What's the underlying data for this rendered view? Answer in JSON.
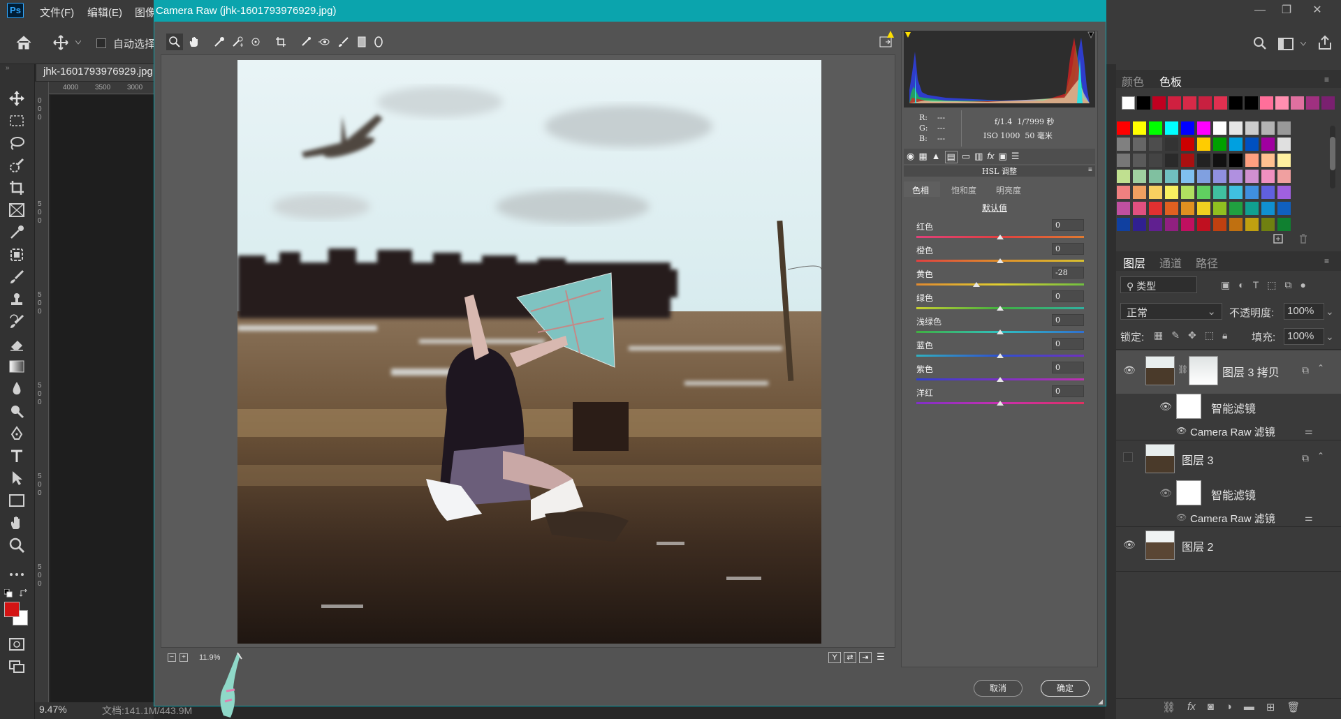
{
  "ps": {
    "menu": [
      "文件(F)",
      "编辑(E)",
      "图像"
    ],
    "logo": "Ps",
    "autoselect_label": "自动选择",
    "doc_tab": "jhk-1601793976929.jpg",
    "ruler_top": [
      "4000",
      "3500",
      "3000"
    ],
    "ruler_left": [
      "0",
      "0",
      "0",
      "5",
      "0",
      "0",
      "5",
      "0",
      "0",
      "5",
      "0",
      "0",
      "5",
      "0",
      "0",
      "5",
      "0",
      "0"
    ],
    "status_zoom": "9.47%",
    "status_doc": "文档:141.1M/443.9M",
    "window_buttons": [
      "—",
      "❐",
      "✕"
    ]
  },
  "camera_raw": {
    "title": "Camera Raw (jhk-1601793976929.jpg)",
    "zoom": "11.9%",
    "info": {
      "r_label": "R:",
      "g_label": "G:",
      "b_label": "B:",
      "r": "---",
      "g": "---",
      "b": "---",
      "aperture_shutter": "f/1.4  1/7999 秒",
      "iso_focal": "ISO 1000  50 毫米"
    },
    "panel_title": "HSL 调整",
    "subtabs": [
      "色相",
      "饱和度",
      "明亮度"
    ],
    "default_link": "默认值",
    "sliders": [
      {
        "label": "红色",
        "value": "0",
        "colors": [
          "#e0407a",
          "#e04040",
          "#e07a30"
        ]
      },
      {
        "label": "橙色",
        "value": "0",
        "colors": [
          "#e04040",
          "#e0902a",
          "#d8c030"
        ]
      },
      {
        "label": "黄色",
        "value": "-28",
        "colors": [
          "#e08a30",
          "#e0d030",
          "#70c040"
        ]
      },
      {
        "label": "绿色",
        "value": "0",
        "colors": [
          "#c8d030",
          "#40b040",
          "#30b0a0"
        ]
      },
      {
        "label": "浅绿色",
        "value": "0",
        "colors": [
          "#40b040",
          "#30c0c0",
          "#3070d0"
        ]
      },
      {
        "label": "蓝色",
        "value": "0",
        "colors": [
          "#30b0c0",
          "#3050d0",
          "#7030c0"
        ]
      },
      {
        "label": "紫色",
        "value": "0",
        "colors": [
          "#3040d0",
          "#7a30c8",
          "#c030b0"
        ]
      },
      {
        "label": "洋红",
        "value": "0",
        "colors": [
          "#8030c8",
          "#c830b0",
          "#e03060"
        ]
      }
    ],
    "slider_levels": [
      0.5,
      0.5,
      0.36,
      0.5,
      0.5,
      0.5,
      0.5,
      0.5
    ],
    "cancel": "取消",
    "ok": "确定"
  },
  "swatches": {
    "tabs": [
      "颜色",
      "色板"
    ],
    "top_row": [
      "#ffffff",
      "#000000",
      "#c00020",
      "#d02040",
      "#d82a48",
      "#c82040",
      "#e03050",
      "#000000",
      "#000000",
      "#ff6f9a",
      "#ff8fb0",
      "#e070a0",
      "#a03080",
      "#7a2070"
    ],
    "grid": [
      [
        "#ff0000",
        "#ffff00",
        "#00ff00",
        "#00ffff",
        "#0000ff",
        "#ff00ff",
        "#ffffff",
        "#e6e6e6",
        "#cccccc",
        "#b3b3b3",
        "#999999"
      ],
      [
        "#808080",
        "#666666",
        "#4d4d4d",
        "#333333",
        "#cc0000",
        "#ffcc00",
        "#00a000",
        "#00a0e0",
        "#0050c0",
        "#a000a0",
        "#e0e0e0"
      ],
      [
        "#777777",
        "#5a5a5a",
        "#444444",
        "#2a2a2a",
        "#aa1010",
        "#222222",
        "#111111",
        "#000000",
        "#ffa080",
        "#ffc090",
        "#fff0a0"
      ],
      [
        "#c0e090",
        "#a0d0a0",
        "#80c0a0",
        "#70c0c0",
        "#80c0f0",
        "#80a0e0",
        "#9090e0",
        "#b090e0",
        "#d090d0",
        "#f090c0",
        "#f0a0a0"
      ],
      [
        "#f08080",
        "#f0a060",
        "#f8d060",
        "#f8f060",
        "#b0e060",
        "#60d060",
        "#40c0a0",
        "#40c0e0",
        "#4090e0",
        "#6060e0",
        "#a060e0"
      ],
      [
        "#c050a0",
        "#e05080",
        "#e03030",
        "#e06020",
        "#e09020",
        "#f0d020",
        "#90c020",
        "#20a040",
        "#10a090",
        "#1090d0",
        "#1060c0"
      ],
      [
        "#1040a0",
        "#302090",
        "#602090",
        "#902080",
        "#c01060",
        "#c01020",
        "#c04010",
        "#c07010",
        "#c0a010",
        "#708010",
        "#108030"
      ]
    ]
  },
  "layers": {
    "tabs": [
      "图层",
      "通道",
      "路径"
    ],
    "filter_kind": "类型",
    "blend_mode": "正常",
    "opacity_label": "不透明度:",
    "opacity": "100%",
    "lock_label": "锁定:",
    "fill_label": "填充:",
    "fill": "100%",
    "items": [
      {
        "name": "图层 3 拷贝",
        "type": "layer"
      },
      {
        "name": "智能滤镜",
        "type": "smart-filter"
      },
      {
        "name": "Camera Raw 滤镜",
        "type": "filter"
      },
      {
        "name": "图层 3",
        "type": "layer"
      },
      {
        "name": "智能滤镜",
        "type": "smart-filter"
      },
      {
        "name": "Camera Raw 滤镜",
        "type": "filter"
      },
      {
        "name": "图层 2",
        "type": "layer"
      }
    ],
    "footer_icons": [
      "link-icon",
      "fx-icon",
      "mask-icon",
      "adjustment-icon",
      "folder-icon",
      "new-layer-icon",
      "trash-icon"
    ]
  }
}
